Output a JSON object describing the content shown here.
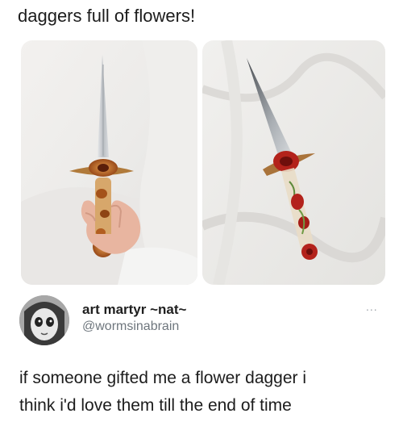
{
  "caption": "daggers full of flowers!",
  "tweet": {
    "display_name": "art martyr ~nat~",
    "handle": "@wormsinabrain",
    "more_label": "...",
    "text_lines": [
      "if someone gifted me a flower dagger i",
      "think i'd love them till the end of time"
    ]
  },
  "colors": {
    "background": "#ffffff",
    "handle_gray": "#6e767d",
    "blade": "#c9ccd0",
    "resin_amber": "#c0621e",
    "rose_red": "#b3221b"
  }
}
